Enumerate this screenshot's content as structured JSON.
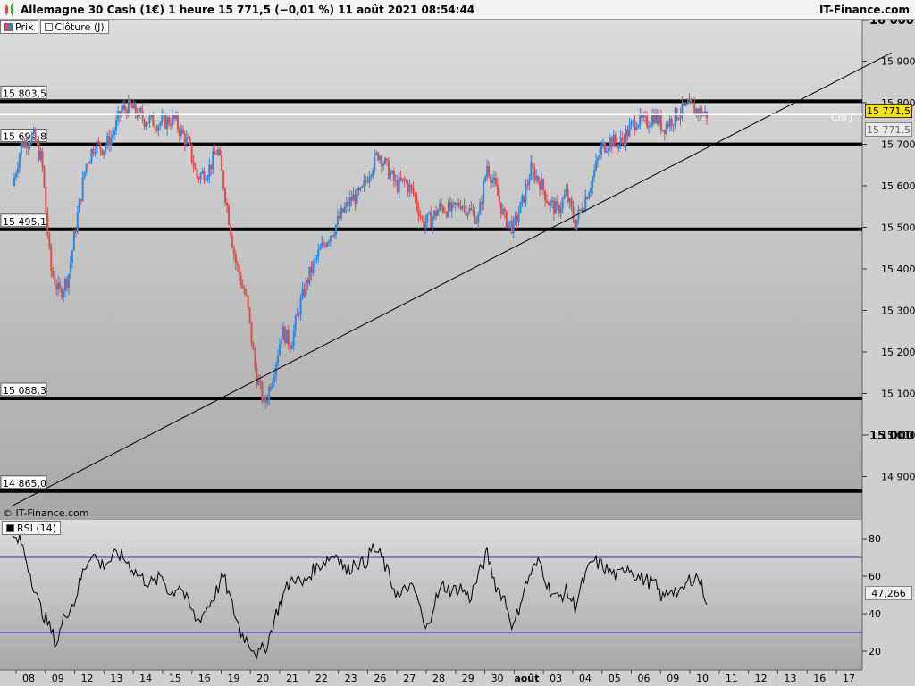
{
  "window": {
    "title": "Allemagne 30 Cash (1€) 1 heure 15 771,5 (−0,01 %) 11 août 2021 08:54:44",
    "brand": "IT-Finance.com",
    "copyright": "© IT-Finance.com"
  },
  "legend": {
    "price_label": "Prix",
    "close_label": "Clôture (J)",
    "rsi_label": "RSI (14)"
  },
  "tags": {
    "current_price": "15 771,5",
    "close_price": "15 771,5",
    "close_line_label": "Clo J",
    "rsi_value": "47,266"
  },
  "colors": {
    "up": "#2e86de",
    "down": "#e24b4b",
    "accent": "#f5e118",
    "rsi_band": "#3030d0"
  },
  "chart_data": [
    {
      "type": "candlestick",
      "title": "Allemagne 30 Cash (1€) 1 heure",
      "ylim": [
        14800,
        16000
      ],
      "y_ticks": [
        15900,
        15800,
        15700,
        15600,
        15500,
        15400,
        15300,
        15200,
        15100,
        15000,
        14900
      ],
      "y_tick_labels": [
        "15 900",
        "15 800",
        "15 700",
        "15 600",
        "15 500",
        "15 400",
        "15 300",
        "15 200",
        "15 100",
        "15 000",
        "14 900"
      ],
      "y_major_ticks": [
        16000,
        15000
      ],
      "y_major_labels": [
        "16 000",
        "15 000"
      ],
      "x_labels": [
        "08",
        "09",
        "12",
        "13",
        "14",
        "15",
        "16",
        "19",
        "20",
        "21",
        "22",
        "23",
        "26",
        "27",
        "28",
        "29",
        "30",
        "août",
        "03",
        "04",
        "05",
        "06",
        "09",
        "10",
        "11",
        "12",
        "13",
        "16",
        "17"
      ],
      "horizontal_levels": [
        {
          "value": 15803.5,
          "label": "15 803,5"
        },
        {
          "value": 15699.8,
          "label": "15 699,8"
        },
        {
          "value": 15495.1,
          "label": "15 495,1"
        },
        {
          "value": 15088.3,
          "label": "15 088,3"
        },
        {
          "value": 14865.0,
          "label": "14 865,0"
        }
      ],
      "close_line": 15771.5,
      "trendline": {
        "from": [
          0,
          14830
        ],
        "to": [
          30,
          15920
        ]
      },
      "path_points": [
        [
          0,
          15600
        ],
        [
          0.3,
          15700
        ],
        [
          0.7,
          15720
        ],
        [
          1.0,
          15660
        ],
        [
          1.3,
          15400
        ],
        [
          1.6,
          15340
        ],
        [
          1.9,
          15380
        ],
        [
          2.2,
          15520
        ],
        [
          2.5,
          15650
        ],
        [
          2.8,
          15700
        ],
        [
          3.1,
          15690
        ],
        [
          3.4,
          15720
        ],
        [
          3.7,
          15780
        ],
        [
          4.0,
          15790
        ],
        [
          4.5,
          15760
        ],
        [
          5.0,
          15750
        ],
        [
          5.5,
          15760
        ],
        [
          6.0,
          15700
        ],
        [
          6.3,
          15620
        ],
        [
          6.7,
          15640
        ],
        [
          7.0,
          15690
        ],
        [
          7.3,
          15560
        ],
        [
          7.6,
          15420
        ],
        [
          8.0,
          15320
        ],
        [
          8.3,
          15150
        ],
        [
          8.6,
          15070
        ],
        [
          8.9,
          15150
        ],
        [
          9.2,
          15250
        ],
        [
          9.5,
          15220
        ],
        [
          9.8,
          15310
        ],
        [
          10.1,
          15380
        ],
        [
          10.4,
          15430
        ],
        [
          10.7,
          15470
        ],
        [
          11.0,
          15500
        ],
        [
          11.3,
          15540
        ],
        [
          11.6,
          15570
        ],
        [
          11.9,
          15580
        ],
        [
          12.2,
          15640
        ],
        [
          12.5,
          15680
        ],
        [
          12.8,
          15640
        ],
        [
          13.1,
          15600
        ],
        [
          13.4,
          15610
        ],
        [
          13.7,
          15580
        ],
        [
          14.0,
          15510
        ],
        [
          14.3,
          15520
        ],
        [
          14.6,
          15550
        ],
        [
          15.0,
          15540
        ],
        [
          15.3,
          15560
        ],
        [
          15.6,
          15540
        ],
        [
          15.9,
          15520
        ],
        [
          16.2,
          15650
        ],
        [
          16.5,
          15590
        ],
        [
          16.8,
          15520
        ],
        [
          17.1,
          15500
        ],
        [
          17.4,
          15560
        ],
        [
          17.7,
          15640
        ],
        [
          18.0,
          15610
        ],
        [
          18.3,
          15560
        ],
        [
          18.6,
          15540
        ],
        [
          18.9,
          15580
        ],
        [
          19.2,
          15510
        ],
        [
          19.5,
          15560
        ],
        [
          19.8,
          15620
        ],
        [
          20.1,
          15690
        ],
        [
          20.4,
          15710
        ],
        [
          20.7,
          15700
        ],
        [
          21.0,
          15730
        ],
        [
          21.3,
          15760
        ],
        [
          21.6,
          15750
        ],
        [
          21.9,
          15770
        ],
        [
          22.2,
          15740
        ],
        [
          22.5,
          15760
        ],
        [
          22.8,
          15780
        ],
        [
          23.1,
          15790
        ],
        [
          23.4,
          15780
        ],
        [
          23.7,
          15771
        ]
      ],
      "series": [
        {
          "name": "Prix"
        }
      ]
    },
    {
      "type": "line",
      "title": "RSI (14)",
      "ylim": [
        10,
        90
      ],
      "y_ticks": [
        80,
        60,
        40,
        20
      ],
      "y_tick_labels": [
        "80",
        "60",
        "40",
        "20"
      ],
      "bands": [
        70,
        30
      ],
      "path_points": [
        [
          0,
          80
        ],
        [
          0.3,
          78
        ],
        [
          0.6,
          62
        ],
        [
          0.9,
          45
        ],
        [
          1.2,
          35
        ],
        [
          1.5,
          24
        ],
        [
          1.8,
          40
        ],
        [
          2.1,
          46
        ],
        [
          2.4,
          62
        ],
        [
          2.7,
          73
        ],
        [
          3.0,
          66
        ],
        [
          3.3,
          68
        ],
        [
          3.6,
          72
        ],
        [
          3.9,
          68
        ],
        [
          4.2,
          62
        ],
        [
          4.5,
          58
        ],
        [
          4.8,
          56
        ],
        [
          5.1,
          60
        ],
        [
          5.4,
          50
        ],
        [
          5.7,
          56
        ],
        [
          6.0,
          45
        ],
        [
          6.3,
          36
        ],
        [
          6.6,
          42
        ],
        [
          6.9,
          50
        ],
        [
          7.2,
          60
        ],
        [
          7.5,
          44
        ],
        [
          7.8,
          30
        ],
        [
          8.1,
          24
        ],
        [
          8.4,
          18
        ],
        [
          8.7,
          24
        ],
        [
          9.0,
          40
        ],
        [
          9.3,
          52
        ],
        [
          9.6,
          60
        ],
        [
          9.9,
          55
        ],
        [
          10.2,
          62
        ],
        [
          10.5,
          66
        ],
        [
          10.8,
          70
        ],
        [
          11.1,
          72
        ],
        [
          11.4,
          62
        ],
        [
          11.7,
          68
        ],
        [
          12.0,
          66
        ],
        [
          12.3,
          75
        ],
        [
          12.6,
          70
        ],
        [
          12.9,
          58
        ],
        [
          13.2,
          48
        ],
        [
          13.5,
          55
        ],
        [
          13.8,
          50
        ],
        [
          14.1,
          30
        ],
        [
          14.4,
          46
        ],
        [
          14.7,
          55
        ],
        [
          15.0,
          52
        ],
        [
          15.3,
          54
        ],
        [
          15.6,
          48
        ],
        [
          15.9,
          60
        ],
        [
          16.2,
          72
        ],
        [
          16.5,
          55
        ],
        [
          16.8,
          48
        ],
        [
          17.1,
          32
        ],
        [
          17.4,
          50
        ],
        [
          17.7,
          62
        ],
        [
          18.0,
          68
        ],
        [
          18.3,
          54
        ],
        [
          18.6,
          48
        ],
        [
          18.9,
          52
        ],
        [
          19.2,
          44
        ],
        [
          19.5,
          58
        ],
        [
          19.8,
          68
        ],
        [
          20.1,
          66
        ],
        [
          20.4,
          62
        ],
        [
          20.7,
          60
        ],
        [
          21.0,
          66
        ],
        [
          21.3,
          60
        ],
        [
          21.6,
          58
        ],
        [
          21.9,
          56
        ],
        [
          22.2,
          48
        ],
        [
          22.5,
          54
        ],
        [
          22.8,
          50
        ],
        [
          23.1,
          58
        ],
        [
          23.4,
          60
        ],
        [
          23.7,
          47.266
        ]
      ],
      "series": [
        {
          "name": "RSI (14)"
        }
      ]
    }
  ]
}
